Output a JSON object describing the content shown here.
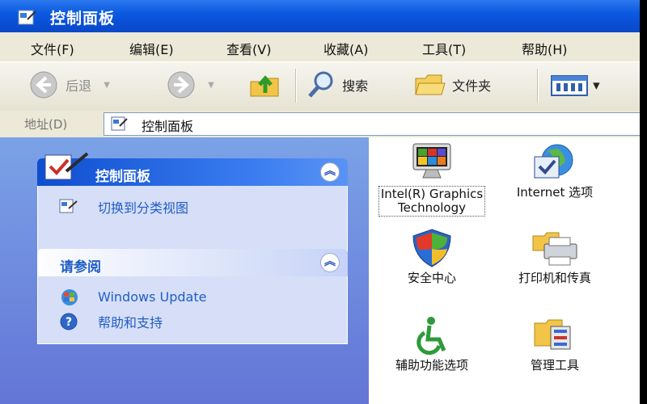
{
  "window": {
    "title": "控制面板"
  },
  "menu": [
    "文件(F)",
    "编辑(E)",
    "查看(V)",
    "收藏(A)",
    "工具(T)",
    "帮助(H)"
  ],
  "toolbar": {
    "back": "后退",
    "search": "搜索",
    "folders": "文件夹"
  },
  "address": {
    "label": "地址(D)",
    "value": "控制面板"
  },
  "sidebar": {
    "control_panel": {
      "title": "控制面板",
      "link": "切换到分类视图"
    },
    "see_also": {
      "title": "请参阅",
      "links": [
        "Windows Update",
        "帮助和支持"
      ]
    }
  },
  "items": [
    {
      "label": "Intel(R) Graphics Technology",
      "icon": "monitor-icon"
    },
    {
      "label": "Internet 选项",
      "icon": "globe-icon"
    },
    {
      "label": "安全中心",
      "icon": "shield-icon"
    },
    {
      "label": "打印机和传真",
      "icon": "printer-icon"
    },
    {
      "label": "辅助功能选项",
      "icon": "accessibility-icon"
    },
    {
      "label": "管理工具",
      "icon": "admin-tools-icon"
    }
  ],
  "colors": {
    "title_bar": "#0a4fd6",
    "sidebar": "#7ba2e7",
    "link": "#215dc6"
  }
}
